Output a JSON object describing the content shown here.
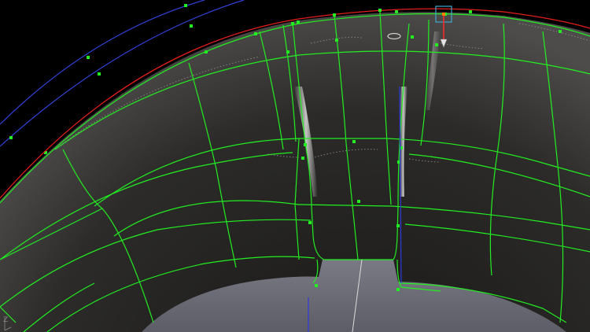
{
  "viewport": {
    "axis_label": "Z",
    "colors": {
      "background": "#000000",
      "surface_light": "#5a5857",
      "surface_dark": "#252422",
      "hub": "#6c6c76",
      "wireframe": "#22ee22",
      "control_point": "#22ee22",
      "outer_edge_curve": "#e61d1d",
      "construction_curve": "#3142d8",
      "axis_line": "#2d3bdc",
      "selection_box": "#3fa7cf",
      "gizmo_arrow": "#ff2a2a"
    },
    "icons": [
      "pivot-ring-icon",
      "transform-gizmo-icon",
      "axis-triad-icon"
    ]
  }
}
